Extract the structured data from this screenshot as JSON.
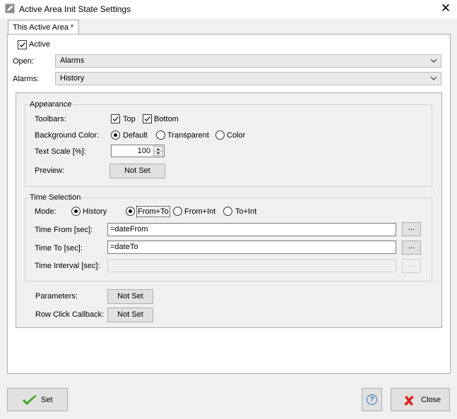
{
  "window": {
    "title": "Active Area Init State Settings",
    "close_glyph": "✕"
  },
  "tab": {
    "label": "This Active Area *"
  },
  "active": {
    "label": "Active",
    "checked": true
  },
  "open": {
    "label": "Open:",
    "value": "Alarms"
  },
  "alarms": {
    "label": "Alarms:",
    "value": "History"
  },
  "appearance": {
    "title": "Appearance",
    "toolbars_label": "Toolbars:",
    "toolbar_top": "Top",
    "toolbar_bottom": "Bottom",
    "bg_label": "Background Color:",
    "bg_options": [
      "Default",
      "Transparent",
      "Color"
    ],
    "bg_selected": "Default",
    "scale_label": "Text Scale [%]:",
    "scale_value": "100",
    "preview_label": "Preview:",
    "preview_button": "Not Set"
  },
  "time_selection": {
    "title": "Time Selection",
    "mode_label": "Mode:",
    "modes": [
      "History",
      "From+To",
      "From+Int",
      "To+Int"
    ],
    "selected_modes": [
      "History",
      "From+To"
    ],
    "from_label": "Time From [sec]:",
    "from_value": "=dateFrom",
    "to_label": "Time To [sec]:",
    "to_value": "=dateTo",
    "interval_label": "Time Interval [sec]:",
    "interval_value": "",
    "browse_label": "..."
  },
  "parameters": {
    "label": "Parameters:",
    "button": "Not Set"
  },
  "row_click": {
    "label": "Row Click Callback:",
    "button": "Not Set"
  },
  "footer": {
    "set_label": "Set",
    "help_glyph": "?",
    "close_label": "Close"
  },
  "icons": {
    "app": "pencil-icon",
    "checkmark": "check-icon",
    "dropdown": "chevron-down-icon",
    "help": "help-icon",
    "close": "red-x-icon"
  },
  "colors": {
    "set_check": "#3aa01e",
    "close_x": "#d9201c",
    "help_ring": "#2f6fbf"
  }
}
